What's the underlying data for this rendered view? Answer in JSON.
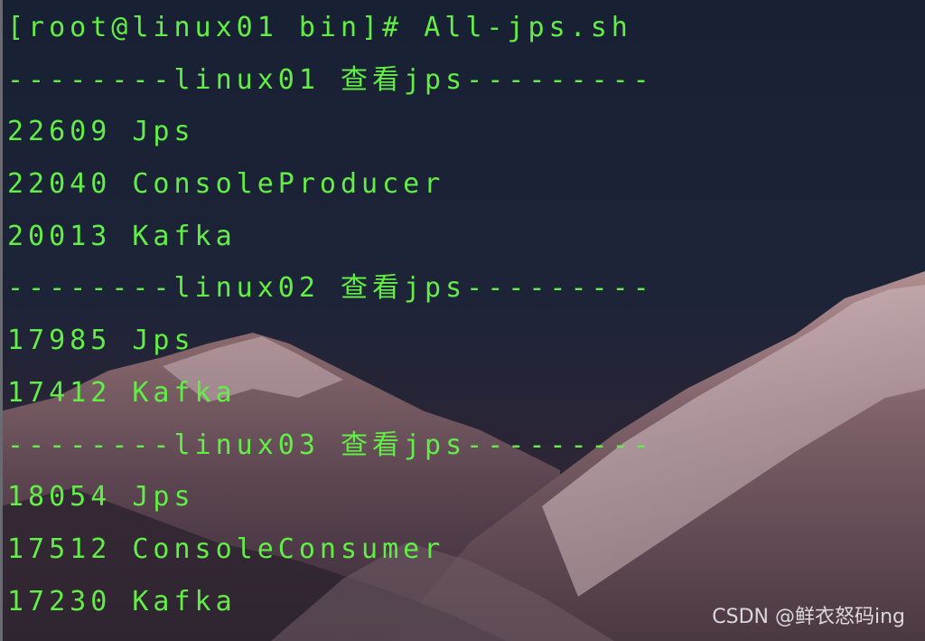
{
  "terminal": {
    "lines": [
      "[root@linux01 bin]# All-jps.sh",
      "--------linux01 查看jps---------",
      "22609 Jps",
      "22040 ConsoleProducer",
      "20013 Kafka",
      "--------linux02 查看jps---------",
      "17985 Jps",
      "17412 Kafka",
      "--------linux03 查看jps---------",
      "18054 Jps",
      "17512 ConsoleConsumer",
      "17230 Kafka"
    ],
    "text_color": "#62ee46"
  },
  "watermark": "CSDN @鲜衣怒码ing"
}
